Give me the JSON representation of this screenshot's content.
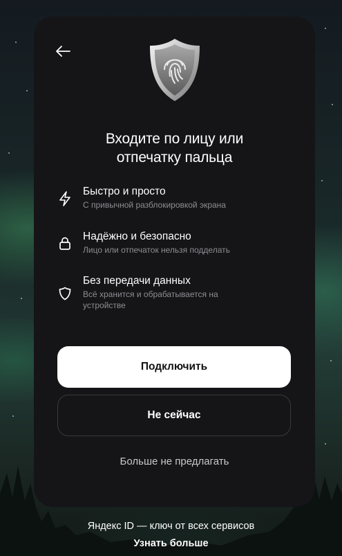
{
  "card": {
    "title_line1": "Входите по лицу или",
    "title_line2": "отпечатку пальца",
    "back_icon": "arrow-left-icon",
    "shield_icon": "fingerprint-shield-icon"
  },
  "features": [
    {
      "icon": "lightning-icon",
      "title": "Быстро и просто",
      "description": "С привычной разблокировкой экрана"
    },
    {
      "icon": "lock-icon",
      "title": "Надёжно и безопасно",
      "description": "Лицо или отпечаток нельзя подделать"
    },
    {
      "icon": "shield-icon",
      "title": "Без передачи данных",
      "description": "Всё хранится и обрабатывается на устройстве"
    }
  ],
  "buttons": {
    "connect": "Подключить",
    "not_now": "Не сейчас",
    "dont_offer": "Больше не предлагать"
  },
  "footer": {
    "text": "Яндекс ID — ключ от всех сервисов",
    "link": "Узнать больше"
  },
  "colors": {
    "card_bg": "#151417",
    "primary_button_bg": "#ffffff",
    "muted_text": "#8e8d93"
  }
}
